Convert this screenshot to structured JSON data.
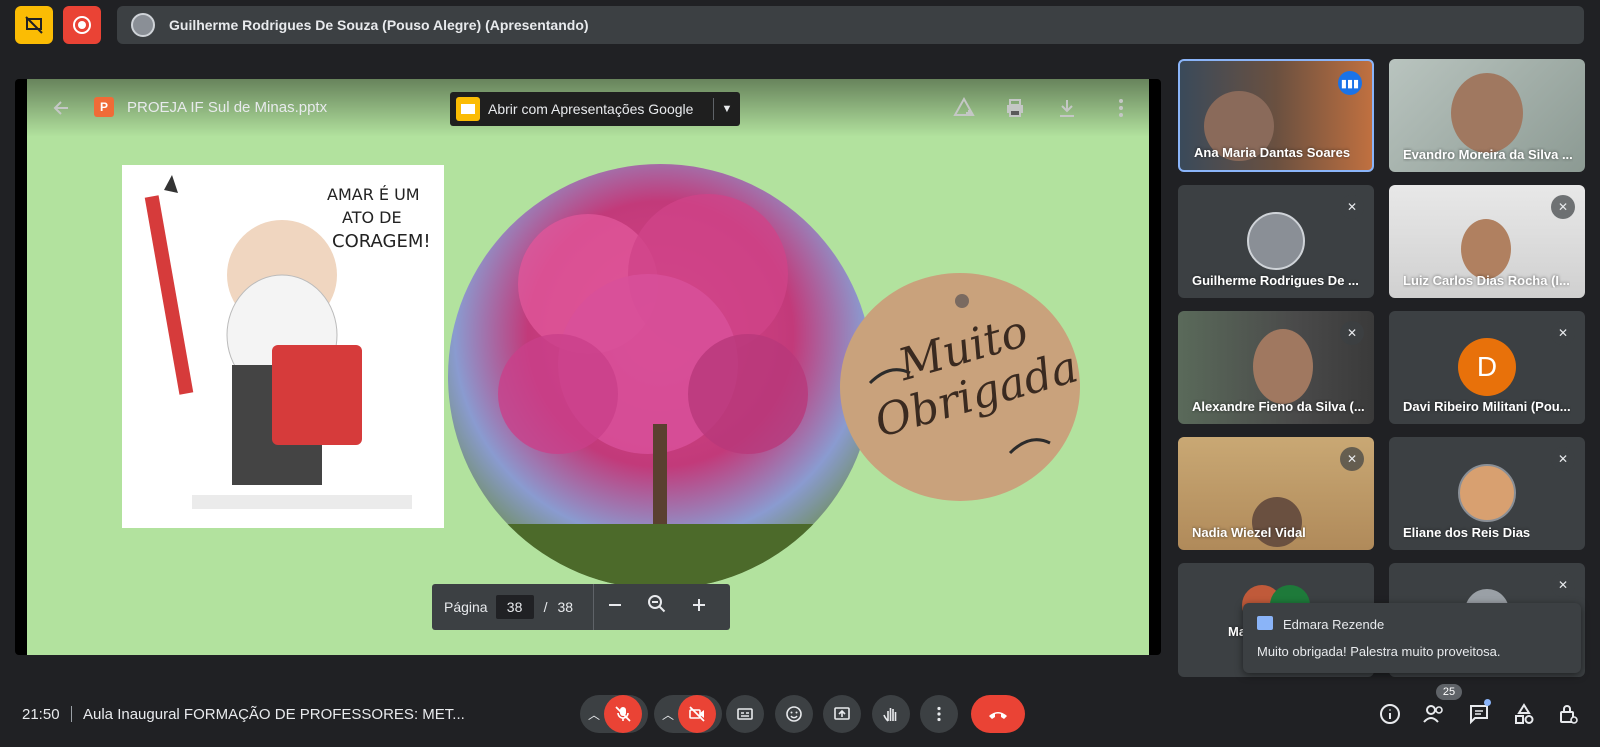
{
  "top": {
    "presenter_label": "Guilherme Rodrigues De Souza (Pouso Alegre) (Apresentando)"
  },
  "viewer": {
    "filename": "PROEJA IF Sul de Minas.pptx",
    "open_with_label": "Abrir com Apresentações Google",
    "page_label": "Página",
    "page_current": "38",
    "page_separator": "/",
    "page_total": "38"
  },
  "slide": {
    "cartoon_text": "AMAR É UM ATO DE CORAGEM!",
    "thanks_text": "Muito Obrigada"
  },
  "participants": [
    {
      "name": "Ana Maria Dantas Soares",
      "speaking": true
    },
    {
      "name": "Evandro Moreira da Silva ..."
    },
    {
      "name": "Guilherme Rodrigues De ...",
      "muted": true
    },
    {
      "name": "Luiz Carlos Dias Rocha (I...",
      "muted": true
    },
    {
      "name": "Alexandre Fieno da Silva (...",
      "muted": true
    },
    {
      "name": "Davi Ribeiro Militani (Pou...",
      "muted": true,
      "initial": "D",
      "avatar_color": "#e8710a"
    },
    {
      "name": "Nadia Wiezel Vidal",
      "muted": true
    },
    {
      "name": "Eliane dos Reis Dias",
      "muted": true
    },
    {
      "name": "Ma",
      "muted": false
    },
    {
      "name": "",
      "muted": true
    }
  ],
  "chat_toast": {
    "sender": "Edmara Rezende",
    "message": "Muito obrigada! Palestra muito proveitosa."
  },
  "bottom": {
    "time": "21:50",
    "meeting_title": "Aula Inaugural FORMAÇÃO DE PROFESSORES: MET...",
    "participant_count": "25"
  },
  "colors": {
    "slide_bg": "#b2e29e",
    "danger": "#ea4335",
    "accent": "#1a73e8"
  }
}
